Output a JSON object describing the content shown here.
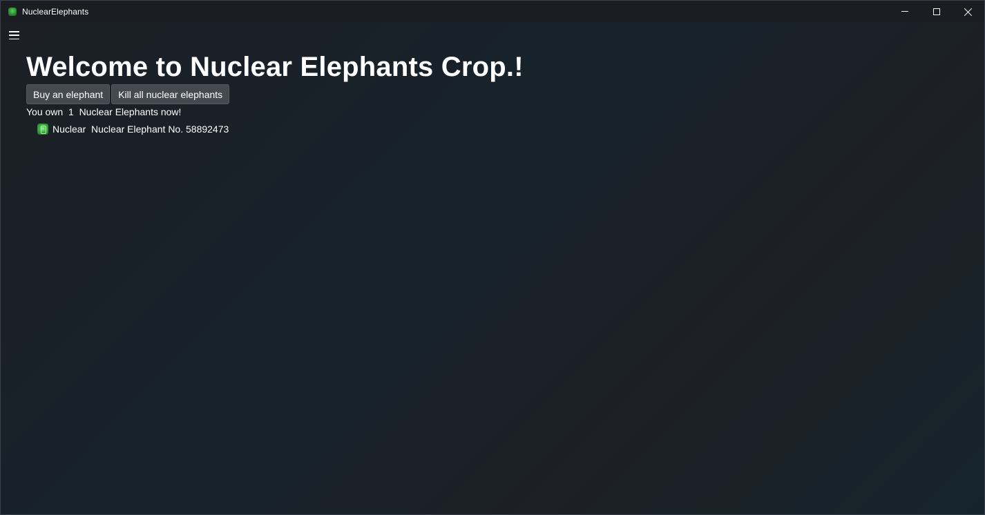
{
  "window": {
    "title": "NuclearElephants",
    "app_icon": "nuclear-elephant-icon",
    "controls": {
      "minimize": "minimize-icon",
      "maximize": "maximize-icon",
      "close": "close-icon"
    }
  },
  "menu": {
    "icon": "hamburger-menu-icon"
  },
  "main": {
    "heading": "Welcome to Nuclear Elephants Crop.!",
    "buttons": {
      "buy": "Buy an elephant",
      "kill": "Kill all nuclear elephants"
    },
    "own_prefix": "You own",
    "own_count": "1",
    "own_suffix": "Nuclear Elephants now!",
    "elephants": [
      {
        "type": "Nuclear",
        "name": "Nuclear Elephant No. 58892473",
        "icon": "nuclear-elephant-icon"
      }
    ]
  },
  "colors": {
    "background": "#1b1f25",
    "button_bg": "#454950",
    "text": "#ffffff",
    "accent_green": "#3fae3f"
  }
}
